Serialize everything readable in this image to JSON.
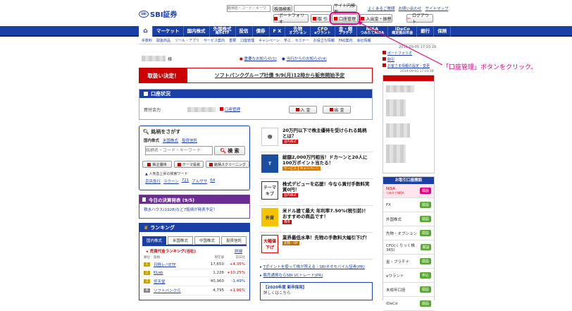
{
  "logo": {
    "mark": "SBI",
    "text": "SBI証券"
  },
  "search": {
    "placeholder": "銘柄名・コード・キーワ",
    "btn": "株価検索",
    "site_btn": "サイト内検索"
  },
  "toplinks": [
    "よくあるご質問",
    "お問い合わせ",
    "サイトマップ"
  ],
  "header_buttons": {
    "portfolio": "ポートフォリオ",
    "trade": "取 引",
    "account": "口座管理",
    "deposit": "入出金・振替",
    "logout": "ログアウト"
  },
  "nav": {
    "items": [
      "マーケット",
      "国内株式",
      "外国株式|海外ETF",
      "投信",
      "債券",
      "F X",
      "先物|オプション",
      "CFD|eワラント",
      "金・銀|プラチナ",
      "NISA|つみたてNISA",
      "iDeCo|確定拠出年金",
      "銀行",
      "保険"
    ]
  },
  "subnav": [
    "手数料",
    "取扱商品",
    "ツール・アプリ",
    "サービス案内",
    "重要",
    "口座管理",
    "キャンペーン",
    "学ぶ",
    "セミナー",
    "お役立ち情報",
    "FAQ案内",
    "会社情報"
  ],
  "timestamp": "2019-09-05 17:03:18",
  "user": {
    "suffix": "様"
  },
  "notices": {
    "important": "重要なお知らせ(1)",
    "yours": "当行からのお知らせ(4)"
  },
  "banner": {
    "label": "取扱い決定！",
    "text": "ソフトバンクグループ社債 9/9(月)12時から販売開始予定"
  },
  "account_status": {
    "title": "口座状況",
    "label": "買付余力",
    "link": "口座管理",
    "deposit_btn": "入 金",
    "withdraw_btn": "出 金"
  },
  "stock_search": {
    "title": "銘柄をさがす",
    "tabs": [
      "国内株式",
      "米国株式",
      "投資信託"
    ],
    "placeholder": "銘柄名・コード・キーワード",
    "btn": "検 索",
    "links": [
      "株主優待",
      "テーマ投資",
      "銘柄スクリーニング"
    ],
    "popular_label": "人気急上昇の検索ワード",
    "popular": [
      "京浜急行",
      "ラクーン",
      "721",
      "アルザサ",
      "64"
    ]
  },
  "earnings": {
    "title": "今日の決算発表 (9/5)",
    "text": "積水ハウス(1928)など7銘柄が発表予定！"
  },
  "ranking": {
    "title": "ランキング",
    "tabs": [
      "国内株式",
      "米国株式",
      "中国株式",
      "投資信託"
    ],
    "sub": "売買代金ランキング(当社)",
    "more": "詳細",
    "cols": [
      "順位",
      "銘柄",
      "現在値",
      "前日比"
    ],
    "rows": [
      {
        "rank": "1",
        "name": "日経レバETF",
        "price": "17,650",
        "chg": "+4.35%",
        "up": true
      },
      {
        "rank": "2",
        "name": "KLab",
        "price": "1,226",
        "chg": "+10.25%",
        "up": true
      },
      {
        "rank": "3",
        "name": "任天堂",
        "price": "40,960",
        "chg": "-1.49%",
        "up": false
      },
      {
        "rank": "4",
        "name": "ソフトバンクＧ",
        "price": "4,795",
        "chg": "+1.96%",
        "up": true
      }
    ]
  },
  "promos": [
    {
      "title": "20万円以下で株主優待を受けられる銘柄とは？",
      "tags": [
        "国内株式"
      ],
      "icon": "gift"
    },
    {
      "title": "総額2,000万円相当！ドカ～ンと20人に100万ポイント当たる！",
      "tags": [
        "サービス",
        "キャンペーン"
      ],
      "icon": "T"
    },
    {
      "title": "株式デビューを応援！今なら買付手数料実質0円！",
      "tags": [
        "国内株式"
      ],
      "icon": "テーマキブ"
    },
    {
      "title": "米ドル建て最大 年利率7.50%(税引前)！おすすめの商品です！",
      "tags": [
        "債券"
      ],
      "icon": "外貨"
    },
    {
      "title": "業界最低水準！先物の手数料大幅引下げ！",
      "tags": [
        "先物・OP"
      ],
      "icon": "大幅値下げ"
    }
  ],
  "bottom_links": [
    "Tポイントを使って株が買える｜SBIネオモバイル証券(PR)",
    "販売通貨ならSBI VCトレード(PR)"
  ],
  "recruit": {
    "title": "【2020年度 新卒採用】",
    "text": "詳しくはこちら"
  },
  "right_links": [
    "ポートフォリオ",
    "取引",
    "お客さま情報の設定・変更"
  ],
  "right_timestamp": "2019-09-05 17:03:18",
  "account_list": {
    "title": "お取引口座開設",
    "items": [
      {
        "name": "NISA|つみたてNISA",
        "btn": "開設"
      },
      {
        "name": "FX",
        "btn": "開設"
      },
      {
        "name": "外国株式",
        "btn": "開設"
      },
      {
        "name": "先物・オプション",
        "btn": "開設"
      },
      {
        "name": "CFD(くりっく株365)",
        "btn": "開設"
      },
      {
        "name": "金・プラチナ",
        "btn": "開設"
      },
      {
        "name": "eワラント",
        "btn": "申込"
      },
      {
        "name": "未成年口座",
        "btn": "開設"
      },
      {
        "name": "iDeCo",
        "btn": "開設"
      }
    ]
  },
  "annotation": "「口座管理」ボタンをクリック。",
  "colors": {
    "brand": "#1a3fa6",
    "red": "#c00000",
    "highlight": "#e4007f"
  }
}
